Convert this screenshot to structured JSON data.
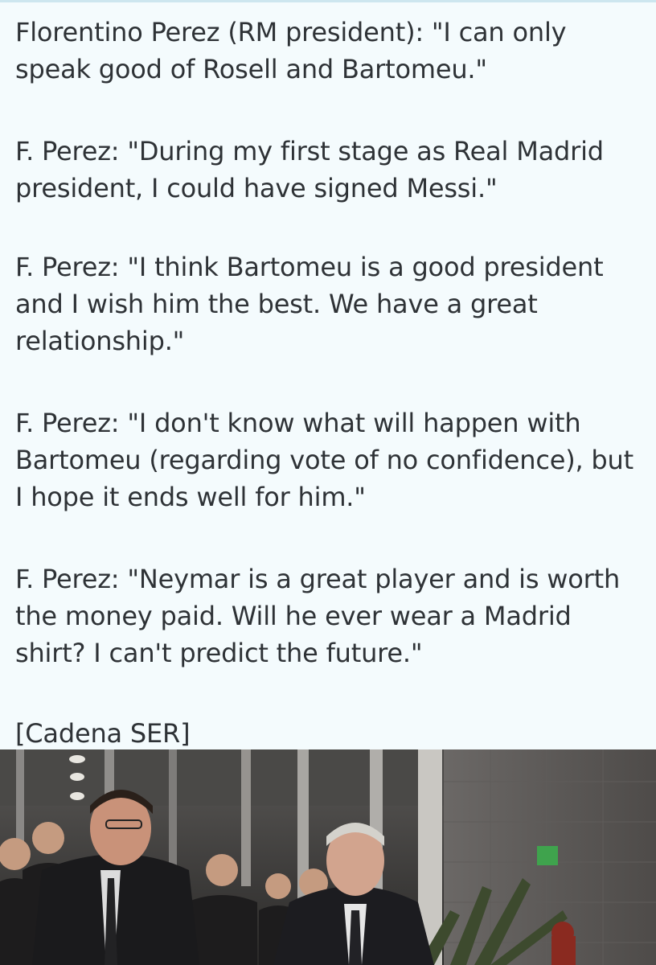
{
  "post": {
    "paragraphs": [
      "Florentino Perez (RM president): \"I can only\nspeak good of Rosell and Bartomeu.\"",
      "F. Perez: \"During my first stage as Real Madrid\npresident, I could have signed Messi.\"",
      "F. Perez: \"I think Bartomeu is a good president\nand I wish him the best. We have a great\nrelationship.\"",
      "F. Perez: \"I don't know what will happen with\nBartomeu (regarding vote of no confidence), but\nI hope it ends well for him.\"",
      "F. Perez: \"Neymar is a great player and is worth\nthe money paid. Will he ever wear a Madrid\nshirt? I can't predict the future.\"",
      "[Cadena SER]"
    ]
  },
  "photo": {
    "subject_icon": "news-photo-image"
  },
  "colors": {
    "background": "#f4fbfd",
    "text": "#2e3236"
  }
}
